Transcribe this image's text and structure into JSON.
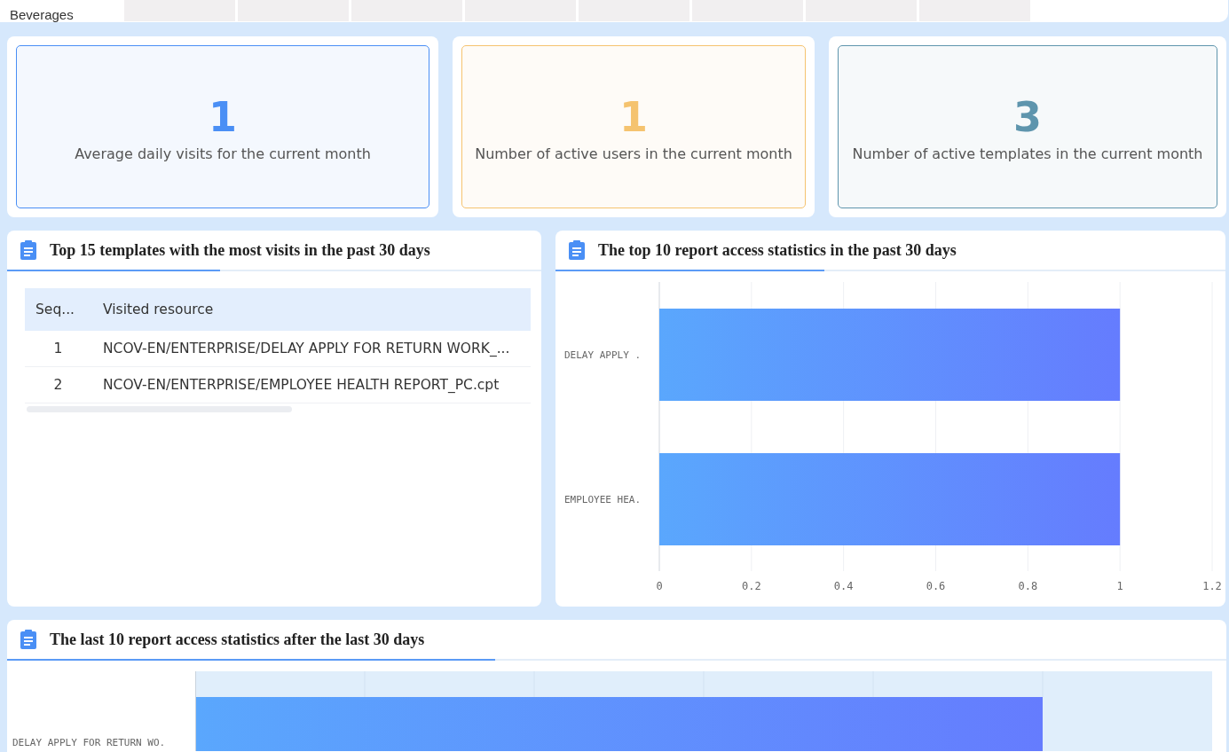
{
  "top_table": {
    "row_label": "Beverages"
  },
  "stats": [
    {
      "value": "1",
      "label": "Average daily visits for the current month",
      "color": "#4a8ff5"
    },
    {
      "value": "1",
      "label": "Number of active users in the current month",
      "color": "#f5c36f"
    },
    {
      "value": "3",
      "label": "Number of active templates in the current month",
      "color": "#5e95ad"
    }
  ],
  "top_templates": {
    "title": "Top 15 templates with the most visits in the past 30 days",
    "columns": [
      "Seq...",
      "Visited resource"
    ],
    "rows": [
      [
        "1",
        "NCOV-EN/ENTERPRISE/DELAY APPLY FOR RETURN WORK_..."
      ],
      [
        "2",
        "NCOV-EN/ENTERPRISE/EMPLOYEE HEALTH REPORT_PC.cpt"
      ]
    ]
  },
  "top_reports": {
    "title": "The top 10 report access statistics in the past 30 days",
    "chart_data": {
      "type": "bar",
      "orientation": "horizontal",
      "grid": true,
      "categories": [
        "DELAY APPLY .",
        "EMPLOYEE HEA."
      ],
      "values": [
        1,
        1
      ],
      "xlim": [
        0,
        1.2
      ],
      "xticks": [
        {
          "value": 0,
          "label": "0"
        },
        {
          "value": 0.2,
          "label": "0.2"
        },
        {
          "value": 0.4,
          "label": "0.4"
        },
        {
          "value": 0.6,
          "label": "0.6"
        },
        {
          "value": 0.8,
          "label": "0.8"
        },
        {
          "value": 1,
          "label": "1"
        },
        {
          "value": 1.2,
          "label": "1.2"
        }
      ]
    }
  },
  "last_reports": {
    "title": "The last 10 report access statistics after the last 30 days",
    "category": "DELAY APPLY FOR RETURN WO."
  }
}
